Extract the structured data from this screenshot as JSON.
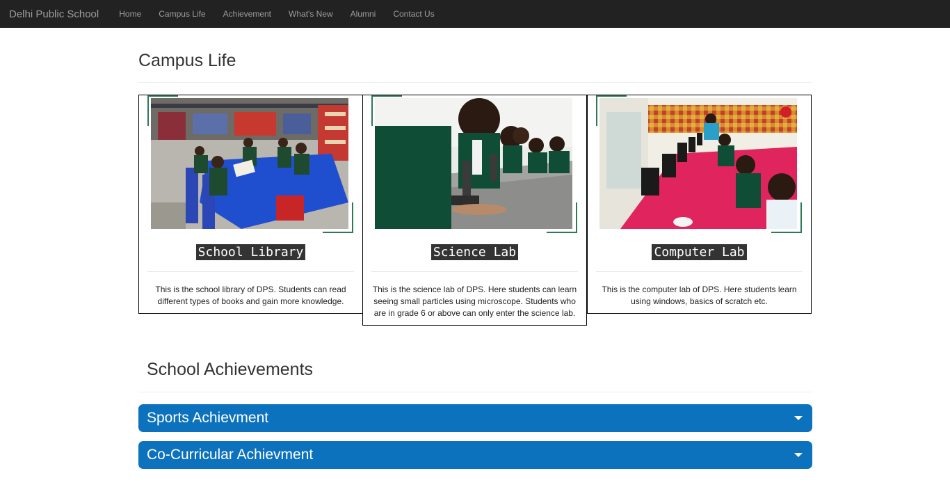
{
  "nav": {
    "brand": "Delhi Public School",
    "links": [
      "Home",
      "Campus Life",
      "Achievement",
      "What's New",
      "Alumni",
      "Contact Us"
    ]
  },
  "campus": {
    "title": "Campus Life",
    "cards": [
      {
        "title": "School Library",
        "text": "This is the school library of DPS. Students can read different types of books and gain more knowledge."
      },
      {
        "title": "Science Lab",
        "text": "This is the science lab of DPS. Here students can learn seeing small particles using microscope. Students who are in grade 6 or above can only enter the science lab."
      },
      {
        "title": "Computer Lab",
        "text": "This is the computer lab of DPS. Here students learn using windows, basics of scratch etc."
      }
    ]
  },
  "achievements": {
    "title": "School Achievements",
    "panels": [
      "Sports Achievment",
      "Co-Curricular Achievment"
    ]
  },
  "colors": {
    "navbar": "#222222",
    "accordion": "#0d72bd",
    "photo_frame": "#2e7a55"
  }
}
